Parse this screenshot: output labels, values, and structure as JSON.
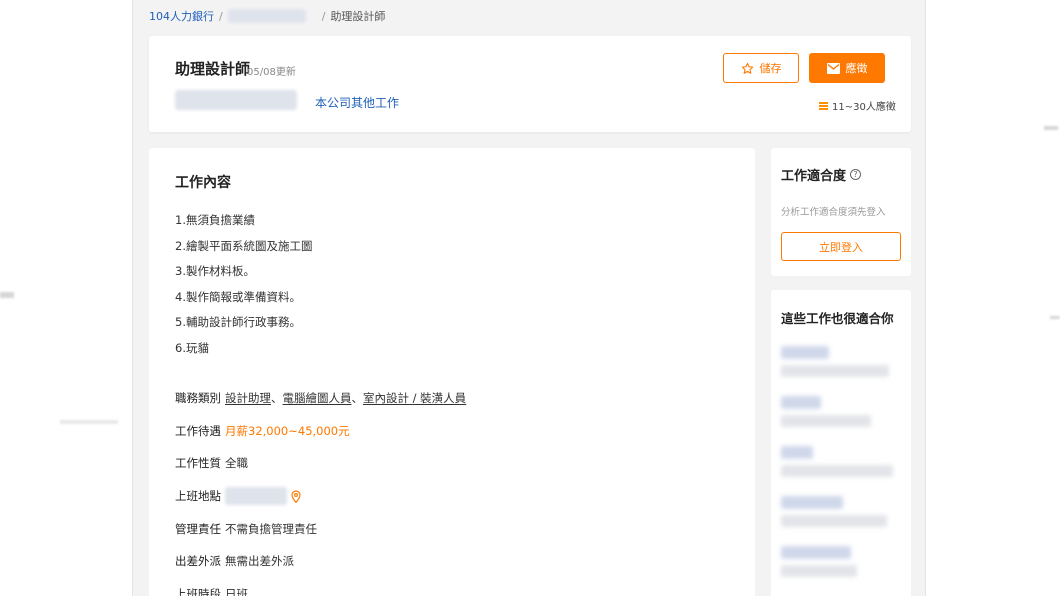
{
  "breadcrumb": {
    "home": "104人力銀行",
    "sep1": "/",
    "sep2": "/",
    "current": "助理設計師"
  },
  "header": {
    "title": "助理設計師",
    "updated": "05/08更新",
    "other_jobs": "本公司其他工作",
    "save_label": "儲存",
    "apply_label": "應徵",
    "applicants": "11~30人應徵"
  },
  "content": {
    "section_title": "工作內容",
    "duties": [
      "1.無須負擔業績",
      "2.繪製平面系統圖及施工圖",
      "3.製作材料板。",
      "4.製作簡報或準備資料。",
      "5.輔助設計師行政事務。",
      "6.玩貓"
    ],
    "details": {
      "category_label": "職務類別",
      "categories": [
        "設計助理",
        "電腦繪圖人員",
        "室內設計 / 裝潢人員"
      ],
      "category_sep": "、",
      "salary_label": "工作待遇",
      "salary": "月薪32,000~45,000元",
      "type_label": "工作性質",
      "type": "全職",
      "location_label": "上班地點",
      "management_label": "管理責任",
      "management": "不需負擔管理責任",
      "travel_label": "出差外派",
      "travel": "無需出差外派",
      "hours_label": "上班時段",
      "hours": "日班"
    }
  },
  "sidebar": {
    "match_title": "工作適合度",
    "help_icon": "?",
    "match_note": "分析工作適合度須先登入",
    "login_label": "立即登入",
    "recommend_title": "這些工作也很適合你"
  },
  "colors": {
    "accent": "#ff7800",
    "link": "#1f5fb8",
    "page_bg": "#f3f3f3"
  },
  "icons": {
    "save": "star-icon",
    "apply": "envelope-icon",
    "applicants": "bar-stack-icon",
    "location": "map-pin-icon",
    "help": "question-circle-icon"
  }
}
